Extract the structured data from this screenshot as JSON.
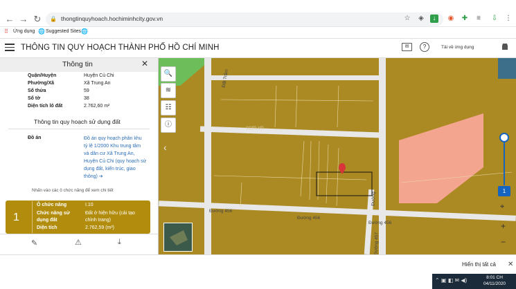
{
  "browser": {
    "url": "thongtinquyhoach.hochiminhcity.gov.vn",
    "bookmarks": [
      {
        "label": "Ứng dụng"
      },
      {
        "label": "Suggested Sites"
      }
    ]
  },
  "app": {
    "title": "THÔNG TIN QUY HOẠCH THÀNH PHỐ HỒ CHÍ MINH",
    "header_link": "Tải về ứng dụng"
  },
  "panel": {
    "title": "Thông tin",
    "fields": [
      {
        "label": "Quận/Huyện",
        "value": "Huyện Củ Chi"
      },
      {
        "label": "Phường/Xã",
        "value": "Xã Trung An"
      },
      {
        "label": "Số thửa",
        "value": "59"
      },
      {
        "label": "Số tờ",
        "value": "38"
      },
      {
        "label": "Diện tích lô đất",
        "value": "2.762,60 m²"
      }
    ],
    "section_title": "Thông tin quy hoạch sử dụng đất",
    "do_an_label": "Đồ án",
    "do_an_lines": [
      "Đồ án quy hoạch phân khu",
      "tỷ lệ 1/2000 Khu trung tâm",
      "và dân cư Xã Trung An,",
      "Huyện Củ Chi (quy hoạch sử",
      "dụng đất, kiến trúc, giao",
      "thông) ➔"
    ],
    "hint": "Nhấn vào các ô chức năng để xem chi tiết",
    "card": {
      "number": "1",
      "rows": [
        {
          "label": "Ô chức năng",
          "value": "I.10"
        },
        {
          "label": "Chức năng sử",
          "value": "Đất ở hiện hữu (cải tạo"
        },
        {
          "label": "dụng đất",
          "value": "chỉnh trang)"
        },
        {
          "label": "Diện tích",
          "value": "2.762,59 (m²)"
        }
      ]
    }
  },
  "map": {
    "roads": {
      "duong_456_left": "Đường 456",
      "duong_456_mid": "Đường 456",
      "duong_456_right": "Đường 456",
      "duong_vertical": "Đường",
      "duong_457": "Đường 457",
      "dat_tram": "Đất Trấm"
    },
    "watermark": "com.vn",
    "zoom_badge": "1"
  },
  "footer": {
    "show_all": "Hiển thị tất cả",
    "clock_time": "8:01 CH",
    "clock_date": "04/11/2020"
  },
  "colors": {
    "parcel": "#ab8a23",
    "pink_zone": "#f4a590",
    "green_zone": "#6dbd5a",
    "card": "#b28d0d"
  }
}
